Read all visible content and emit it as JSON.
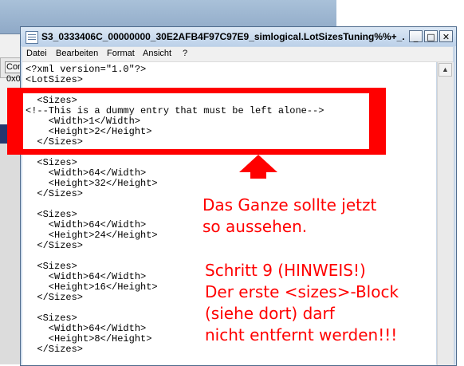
{
  "background_window": {
    "tab_label": "Con",
    "hex_label": "0x0"
  },
  "window": {
    "title": "S3_0333406C_00000000_30E2AFB4F97C97E9_simlogical.LotSizesTuning%%+_...",
    "controls": {
      "minimize": "_",
      "maximize": "□",
      "close": "✕"
    }
  },
  "menu": {
    "items": [
      "Datei",
      "Bearbeiten",
      "Format",
      "Ansicht",
      "?"
    ]
  },
  "editor": {
    "lines": [
      "<?xml version=\"1.0\"?>",
      "<LotSizes>",
      "",
      "  <Sizes>",
      "<!--This is a dummy entry that must be left alone-->",
      "    <Width>1</Width>",
      "    <Height>2</Height>",
      "  </Sizes>",
      "",
      "  <Sizes>",
      "    <Width>64</Width>",
      "    <Height>32</Height>",
      "  </Sizes>",
      "",
      "  <Sizes>",
      "    <Width>64</Width>",
      "    <Height>24</Height>",
      "  </Sizes>",
      "",
      "  <Sizes>",
      "    <Width>64</Width>",
      "    <Height>16</Height>",
      "  </Sizes>",
      "",
      "  <Sizes>",
      "    <Width>64</Width>",
      "    <Height>8</Height>",
      "  </Sizes>"
    ]
  },
  "annotations": {
    "note_1": "Das Ganze sollte jetzt\nso aussehen.",
    "note_2": "Schritt 9 (HINWEIS!)\nDer erste <sizes>-Block\n(siehe dort) darf\nnicht entfernt werden!!!",
    "color": "#ff0000"
  },
  "icons": {
    "app": "notepad-icon",
    "arrow": "up-arrow-icon"
  }
}
